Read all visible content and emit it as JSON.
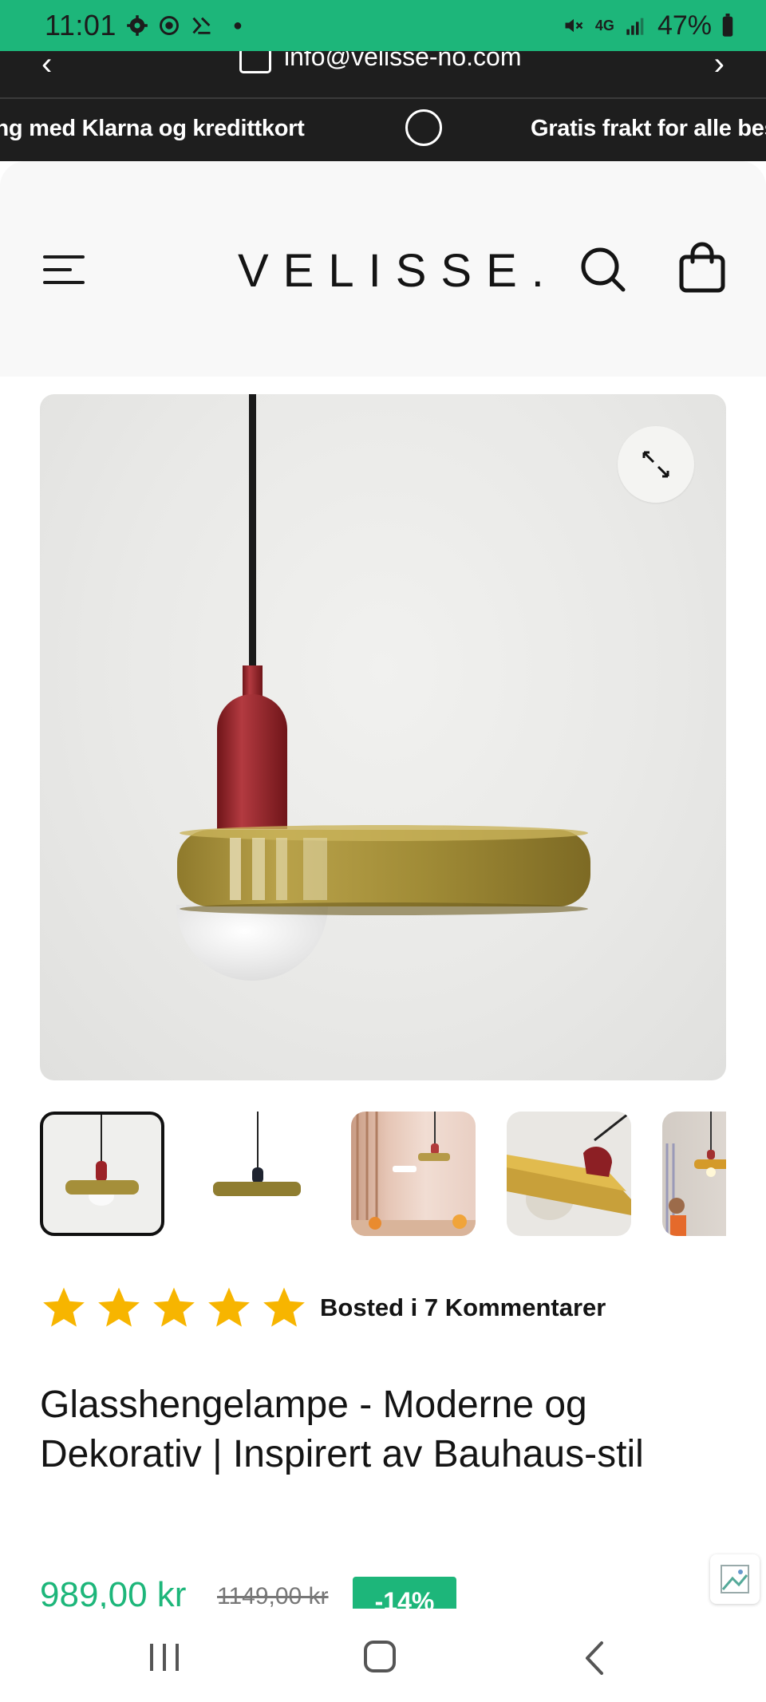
{
  "status_bar": {
    "time": "11:01",
    "battery": "47%",
    "network": "4G"
  },
  "contact_bar": {
    "email": "info@velisse-no.com"
  },
  "marquee": {
    "item_1": "ling med Klarna og kredittkort",
    "item_2": "Gratis frakt for alle bes"
  },
  "header": {
    "logo": "VELISSE."
  },
  "rating": {
    "stars": 5,
    "text": "Bosted i 7 Kommentarer"
  },
  "product": {
    "title": "Glasshengelampe - Moderne og Dekorativ | Inspirert av Bauhaus-stil",
    "price": "989,00 kr",
    "old_price": "1149,00 kr",
    "discount": "-14%"
  },
  "thumbnails": [
    {
      "name": "thumbnail-1",
      "active": true
    },
    {
      "name": "thumbnail-2",
      "active": false
    },
    {
      "name": "thumbnail-3",
      "active": false
    },
    {
      "name": "thumbnail-4",
      "active": false
    },
    {
      "name": "thumbnail-5",
      "active": false
    }
  ],
  "colors": {
    "accent": "#1db67a",
    "dark_bar": "#1e1e1e",
    "lamp_shade": "#a8913a",
    "lamp_cap": "#8c1f24",
    "star": "#f7b500"
  }
}
